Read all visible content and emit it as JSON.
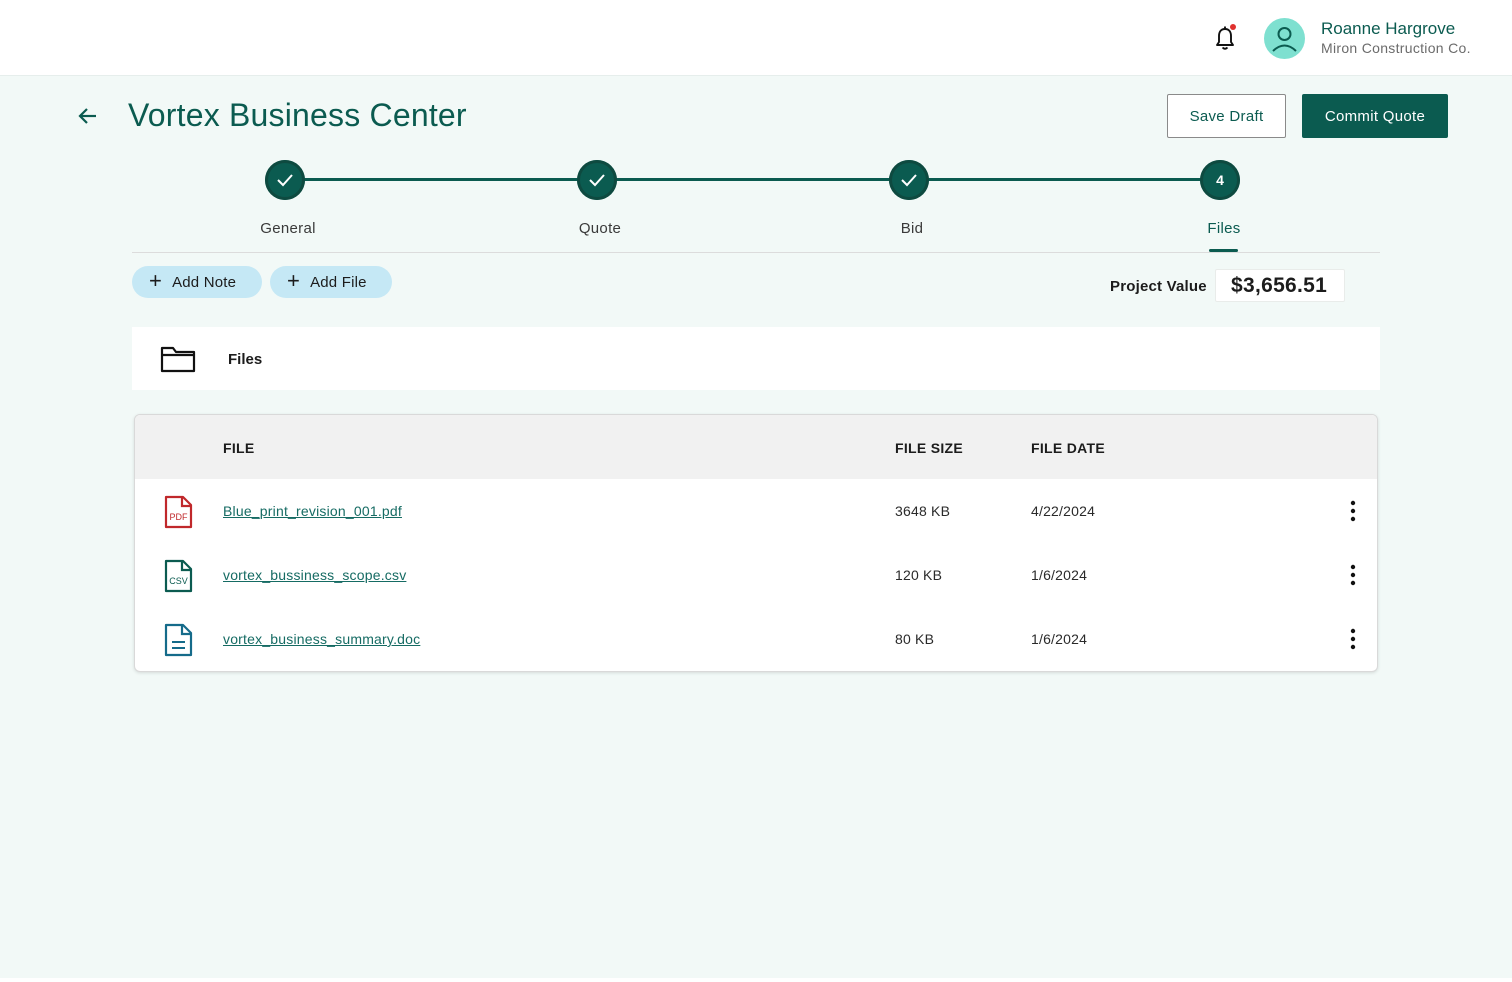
{
  "theme": {
    "primary": "#0b5b50",
    "link": "#156b63",
    "pill_bg": "#c5e8f5",
    "avatar_bg": "#7ee0d0",
    "notification_dot": "#e0312e",
    "pdf_red": "#c0282b"
  },
  "user": {
    "name": "Roanne Hargrove",
    "company": "Miron Construction Co."
  },
  "header": {
    "title": "Vortex Business Center",
    "save_label": "Save Draft",
    "commit_label": "Commit Quote"
  },
  "stepper": {
    "steps": [
      {
        "label": "General",
        "status": "complete"
      },
      {
        "label": "Quote",
        "status": "complete"
      },
      {
        "label": "Bid",
        "status": "complete"
      },
      {
        "label": "Files",
        "status": "active",
        "number": "4"
      }
    ]
  },
  "actions": {
    "add_note": "Add Note",
    "add_file": "Add File"
  },
  "project_value": {
    "label": "Project Value",
    "value": "$3,656.51"
  },
  "files_section": {
    "title": "Files"
  },
  "table": {
    "headers": {
      "file": "FILE",
      "size": "FILE SIZE",
      "date": "FILE DATE"
    },
    "rows": [
      {
        "icon": "pdf-file-icon",
        "name": "Blue_print_revision_001.pdf",
        "size": "3648 KB",
        "date": "4/22/2024"
      },
      {
        "icon": "csv-file-icon",
        "name": "vortex_bussiness_scope.csv",
        "size": "120 KB",
        "date": "1/6/2024"
      },
      {
        "icon": "doc-file-icon",
        "name": "vortex_business_summary.doc",
        "size": "80 KB",
        "date": "1/6/2024"
      }
    ]
  },
  "icon_labels": {
    "pdf": "PDF",
    "csv": "CSV"
  }
}
